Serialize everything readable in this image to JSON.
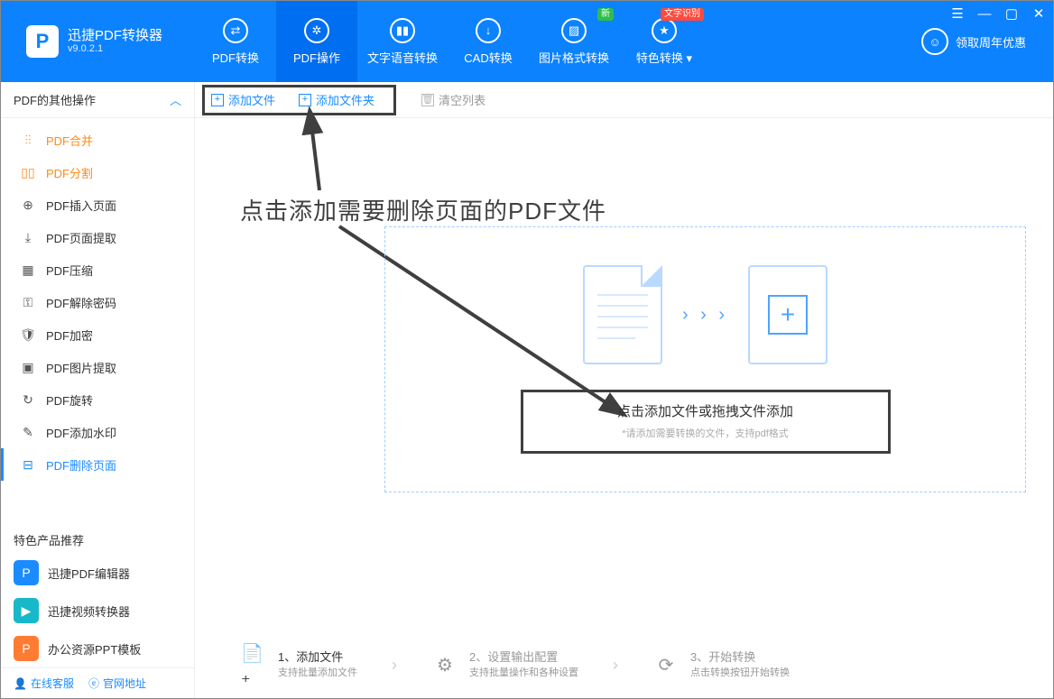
{
  "app": {
    "title": "迅捷PDF转换器",
    "version": "v9.0.2.1"
  },
  "nav": {
    "items": [
      {
        "label": "PDF转换"
      },
      {
        "label": "PDF操作"
      },
      {
        "label": "文字语音转换"
      },
      {
        "label": "CAD转换"
      },
      {
        "label": "图片格式转换",
        "badge": "新"
      },
      {
        "label": "特色转换",
        "badge": "文字识别",
        "dropdown": true
      }
    ],
    "anniversary": "领取周年优惠"
  },
  "sidebar": {
    "header": "PDF的其他操作",
    "items": [
      {
        "label": "PDF合并"
      },
      {
        "label": "PDF分割"
      },
      {
        "label": "PDF插入页面"
      },
      {
        "label": "PDF页面提取"
      },
      {
        "label": "PDF压缩"
      },
      {
        "label": "PDF解除密码"
      },
      {
        "label": "PDF加密"
      },
      {
        "label": "PDF图片提取"
      },
      {
        "label": "PDF旋转"
      },
      {
        "label": "PDF添加水印"
      },
      {
        "label": "PDF删除页面"
      }
    ],
    "recommend_header": "特色产品推荐",
    "recommend": [
      {
        "label": "迅捷PDF编辑器"
      },
      {
        "label": "迅捷视频转换器"
      },
      {
        "label": "办公资源PPT模板"
      }
    ],
    "footer": {
      "support": "在线客服",
      "site": "官网地址"
    }
  },
  "toolbar": {
    "add_file": "添加文件",
    "add_folder": "添加文件夹",
    "clear": "清空列表"
  },
  "annotation": "点击添加需要删除页面的PDF文件",
  "drop": {
    "title": "点击添加文件或拖拽文件添加",
    "sub": "*请添加需要转换的文件，支持pdf格式"
  },
  "steps": [
    {
      "title": "1、添加文件",
      "sub": "支持批量添加文件"
    },
    {
      "title": "2、设置输出配置",
      "sub": "支持批量操作和各种设置"
    },
    {
      "title": "3、开始转换",
      "sub": "点击转换按钮开始转换"
    }
  ]
}
